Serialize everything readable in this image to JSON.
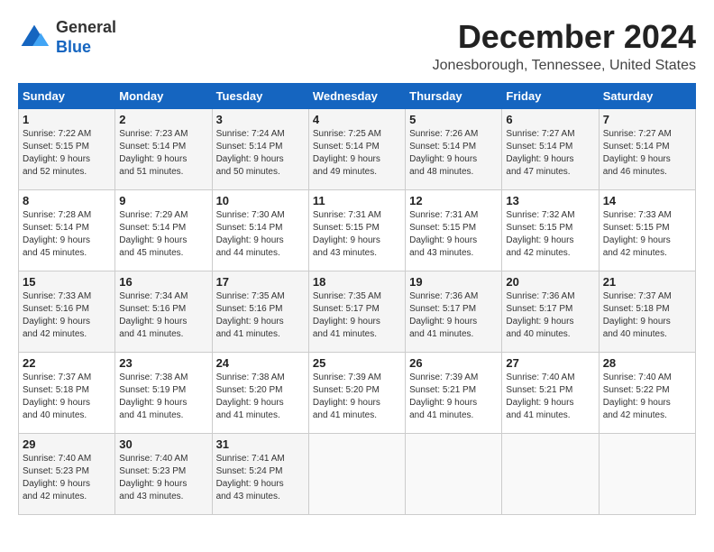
{
  "logo": {
    "general": "General",
    "blue": "Blue"
  },
  "title": "December 2024",
  "subtitle": "Jonesborough, Tennessee, United States",
  "headers": [
    "Sunday",
    "Monday",
    "Tuesday",
    "Wednesday",
    "Thursday",
    "Friday",
    "Saturday"
  ],
  "weeks": [
    [
      {
        "day": "1",
        "sunrise": "7:22 AM",
        "sunset": "5:15 PM",
        "daylight": "9 hours and 52 minutes."
      },
      {
        "day": "2",
        "sunrise": "7:23 AM",
        "sunset": "5:14 PM",
        "daylight": "9 hours and 51 minutes."
      },
      {
        "day": "3",
        "sunrise": "7:24 AM",
        "sunset": "5:14 PM",
        "daylight": "9 hours and 50 minutes."
      },
      {
        "day": "4",
        "sunrise": "7:25 AM",
        "sunset": "5:14 PM",
        "daylight": "9 hours and 49 minutes."
      },
      {
        "day": "5",
        "sunrise": "7:26 AM",
        "sunset": "5:14 PM",
        "daylight": "9 hours and 48 minutes."
      },
      {
        "day": "6",
        "sunrise": "7:27 AM",
        "sunset": "5:14 PM",
        "daylight": "9 hours and 47 minutes."
      },
      {
        "day": "7",
        "sunrise": "7:27 AM",
        "sunset": "5:14 PM",
        "daylight": "9 hours and 46 minutes."
      }
    ],
    [
      {
        "day": "8",
        "sunrise": "7:28 AM",
        "sunset": "5:14 PM",
        "daylight": "9 hours and 45 minutes."
      },
      {
        "day": "9",
        "sunrise": "7:29 AM",
        "sunset": "5:14 PM",
        "daylight": "9 hours and 45 minutes."
      },
      {
        "day": "10",
        "sunrise": "7:30 AM",
        "sunset": "5:14 PM",
        "daylight": "9 hours and 44 minutes."
      },
      {
        "day": "11",
        "sunrise": "7:31 AM",
        "sunset": "5:15 PM",
        "daylight": "9 hours and 43 minutes."
      },
      {
        "day": "12",
        "sunrise": "7:31 AM",
        "sunset": "5:15 PM",
        "daylight": "9 hours and 43 minutes."
      },
      {
        "day": "13",
        "sunrise": "7:32 AM",
        "sunset": "5:15 PM",
        "daylight": "9 hours and 42 minutes."
      },
      {
        "day": "14",
        "sunrise": "7:33 AM",
        "sunset": "5:15 PM",
        "daylight": "9 hours and 42 minutes."
      }
    ],
    [
      {
        "day": "15",
        "sunrise": "7:33 AM",
        "sunset": "5:16 PM",
        "daylight": "9 hours and 42 minutes."
      },
      {
        "day": "16",
        "sunrise": "7:34 AM",
        "sunset": "5:16 PM",
        "daylight": "9 hours and 41 minutes."
      },
      {
        "day": "17",
        "sunrise": "7:35 AM",
        "sunset": "5:16 PM",
        "daylight": "9 hours and 41 minutes."
      },
      {
        "day": "18",
        "sunrise": "7:35 AM",
        "sunset": "5:17 PM",
        "daylight": "9 hours and 41 minutes."
      },
      {
        "day": "19",
        "sunrise": "7:36 AM",
        "sunset": "5:17 PM",
        "daylight": "9 hours and 41 minutes."
      },
      {
        "day": "20",
        "sunrise": "7:36 AM",
        "sunset": "5:17 PM",
        "daylight": "9 hours and 40 minutes."
      },
      {
        "day": "21",
        "sunrise": "7:37 AM",
        "sunset": "5:18 PM",
        "daylight": "9 hours and 40 minutes."
      }
    ],
    [
      {
        "day": "22",
        "sunrise": "7:37 AM",
        "sunset": "5:18 PM",
        "daylight": "9 hours and 40 minutes."
      },
      {
        "day": "23",
        "sunrise": "7:38 AM",
        "sunset": "5:19 PM",
        "daylight": "9 hours and 41 minutes."
      },
      {
        "day": "24",
        "sunrise": "7:38 AM",
        "sunset": "5:20 PM",
        "daylight": "9 hours and 41 minutes."
      },
      {
        "day": "25",
        "sunrise": "7:39 AM",
        "sunset": "5:20 PM",
        "daylight": "9 hours and 41 minutes."
      },
      {
        "day": "26",
        "sunrise": "7:39 AM",
        "sunset": "5:21 PM",
        "daylight": "9 hours and 41 minutes."
      },
      {
        "day": "27",
        "sunrise": "7:40 AM",
        "sunset": "5:21 PM",
        "daylight": "9 hours and 41 minutes."
      },
      {
        "day": "28",
        "sunrise": "7:40 AM",
        "sunset": "5:22 PM",
        "daylight": "9 hours and 42 minutes."
      }
    ],
    [
      {
        "day": "29",
        "sunrise": "7:40 AM",
        "sunset": "5:23 PM",
        "daylight": "9 hours and 42 minutes."
      },
      {
        "day": "30",
        "sunrise": "7:40 AM",
        "sunset": "5:23 PM",
        "daylight": "9 hours and 43 minutes."
      },
      {
        "day": "31",
        "sunrise": "7:41 AM",
        "sunset": "5:24 PM",
        "daylight": "9 hours and 43 minutes."
      },
      null,
      null,
      null,
      null
    ]
  ]
}
